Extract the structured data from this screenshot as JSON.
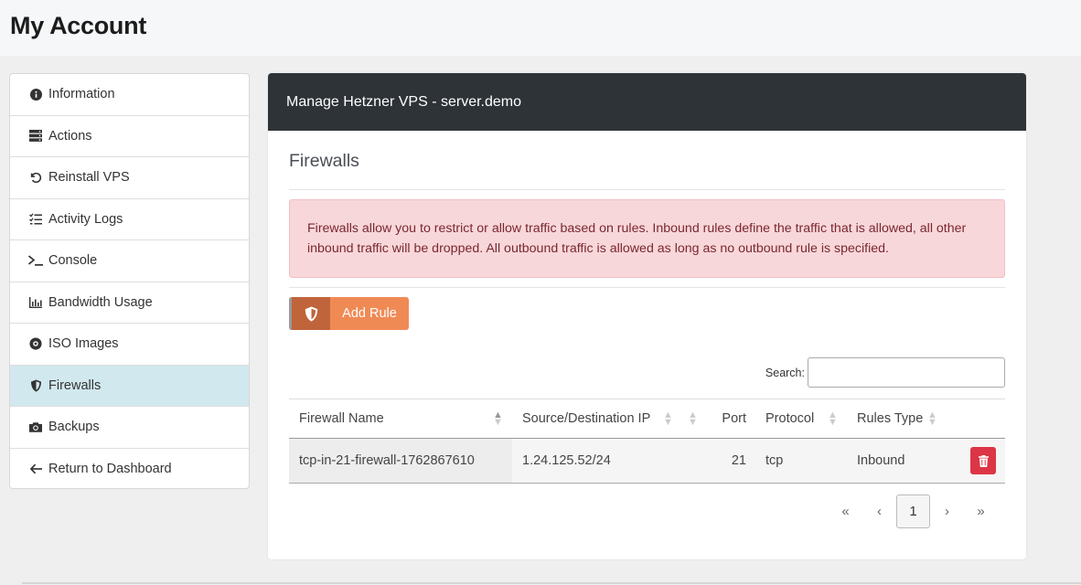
{
  "page": {
    "title": "My Account"
  },
  "sidebar": {
    "items": [
      {
        "label": "Information",
        "icon": "info-icon"
      },
      {
        "label": "Actions",
        "icon": "server-icon"
      },
      {
        "label": "Reinstall VPS",
        "icon": "undo-icon"
      },
      {
        "label": "Activity Logs",
        "icon": "list-check-icon"
      },
      {
        "label": "Console",
        "icon": "terminal-icon"
      },
      {
        "label": "Bandwidth Usage",
        "icon": "chart-bar-icon"
      },
      {
        "label": "ISO Images",
        "icon": "disc-icon"
      },
      {
        "label": "Firewalls",
        "icon": "shield-icon",
        "active": true
      },
      {
        "label": "Backups",
        "icon": "camera-icon"
      },
      {
        "label": "Return to Dashboard",
        "icon": "arrow-left-icon"
      }
    ]
  },
  "panel": {
    "header": "Manage Hetzner VPS - server.demo",
    "section_title": "Firewalls",
    "alert": "Firewalls allow you to restrict or allow traffic based on rules. Inbound rules define the traffic that is allowed, all other inbound traffic will be dropped. All outbound traffic is allowed as long as no outbound rule is specified.",
    "add_rule_label": "Add Rule",
    "search_label": "Search:",
    "search_value": ""
  },
  "table": {
    "columns": [
      "Firewall Name",
      "Source/Destination IP",
      "Port",
      "Protocol",
      "Rules Type"
    ],
    "rows": [
      {
        "name": "tcp-in-21-firewall-1762867610",
        "ip": "1.24.125.52/24",
        "port": "21",
        "protocol": "tcp",
        "type": "Inbound"
      }
    ]
  },
  "pagination": {
    "first": "«",
    "prev": "‹",
    "current": "1",
    "next": "›",
    "last": "»"
  },
  "colors": {
    "header_bg": "#2e3338",
    "active_item": "#d1e8ee",
    "add_rule": "#f08a55",
    "delete": "#dc3545",
    "alert_bg": "#f8d7da"
  }
}
